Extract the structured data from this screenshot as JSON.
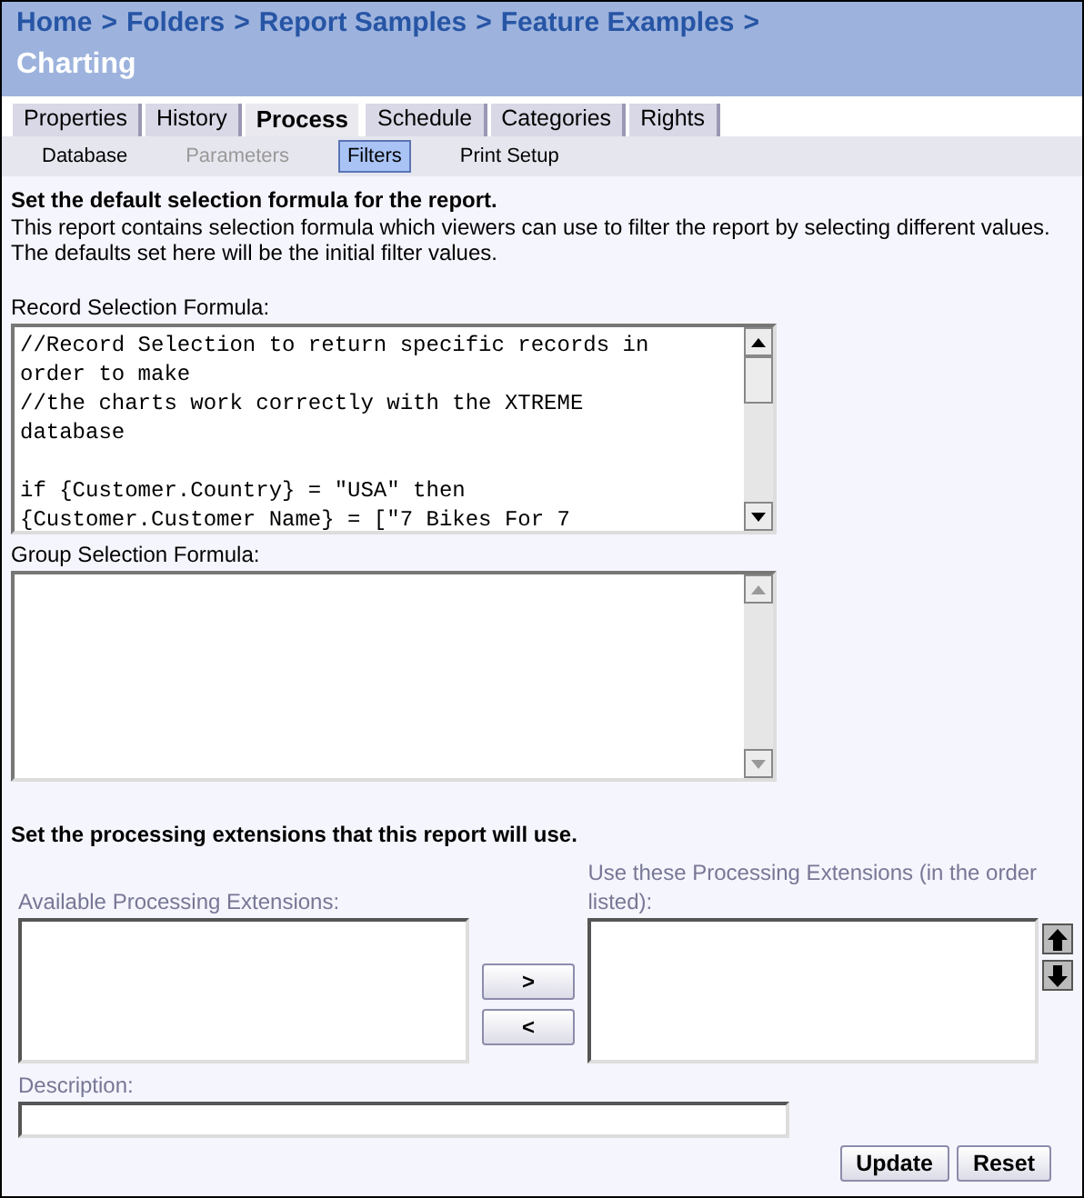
{
  "breadcrumbs": [
    {
      "label": "Home",
      "separator": ">"
    },
    {
      "label": "Folders",
      "separator": ">"
    },
    {
      "label": "Report Samples",
      "separator": ">"
    },
    {
      "label": "Feature Examples",
      "separator": ">"
    }
  ],
  "title": "Charting",
  "tabs": [
    {
      "label": "Properties",
      "selected": false
    },
    {
      "label": "History",
      "selected": false
    },
    {
      "label": "Process",
      "selected": true
    },
    {
      "label": "Schedule",
      "selected": false
    },
    {
      "label": "Categories",
      "selected": false
    },
    {
      "label": "Rights",
      "selected": false
    }
  ],
  "subtabs": [
    {
      "label": "Database",
      "selected": false,
      "disabled": false
    },
    {
      "label": "Parameters",
      "selected": false,
      "disabled": true
    },
    {
      "label": "Filters",
      "selected": true,
      "disabled": false
    },
    {
      "label": "Print Setup",
      "selected": false,
      "disabled": false
    }
  ],
  "selection": {
    "heading": "Set the default selection formula for the report.",
    "description": "This report contains selection formula which viewers can use to filter the report by selecting different values. The defaults set here will be the initial filter values.",
    "record_label": "Record Selection Formula:",
    "record_paragraphs": [
      [
        "//Record Selection to return specific records in",
        "order to make",
        "//the charts work correctly with the XTREME",
        "database"
      ],
      [
        "if {Customer.Country} = \"USA\" then",
        "{Customer.Customer Name} = [\"7 Bikes For 7"
      ]
    ],
    "group_label": "Group Selection Formula:"
  },
  "extensions": {
    "heading": "Set the processing extensions that this report will use.",
    "available_label": {
      "text": "Available Processing Extensions:",
      "disabled": true
    },
    "used_label": {
      "text": "Use these Processing Extensions (in the order listed):",
      "disabled": true
    },
    "add_button": ">",
    "remove_button": "<",
    "description_label": {
      "text": "Description:",
      "disabled": true
    }
  },
  "buttons": [
    "Update",
    "Reset"
  ]
}
